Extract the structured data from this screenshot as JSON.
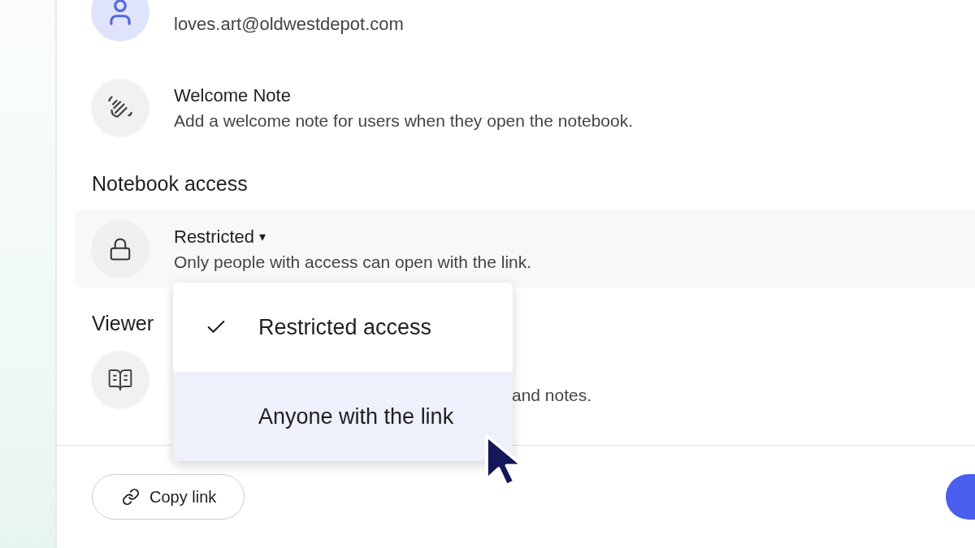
{
  "owner": {
    "email": "loves.art@oldwestdepot.com"
  },
  "welcome_note": {
    "title": "Welcome Note",
    "description": "Add a welcome note for users when they open the notebook."
  },
  "notebook_access": {
    "heading": "Notebook access",
    "value": "Restricted",
    "caret": "▾",
    "description": "Only people with access can open with the link."
  },
  "access_menu": [
    {
      "label": "Restricted access",
      "selected": true,
      "hovered": false
    },
    {
      "label": "Anyone with the link",
      "selected": false,
      "hovered": true
    }
  ],
  "viewers": {
    "heading": "Viewer",
    "description": "and notes."
  },
  "footer": {
    "copy_link": "Copy link"
  }
}
